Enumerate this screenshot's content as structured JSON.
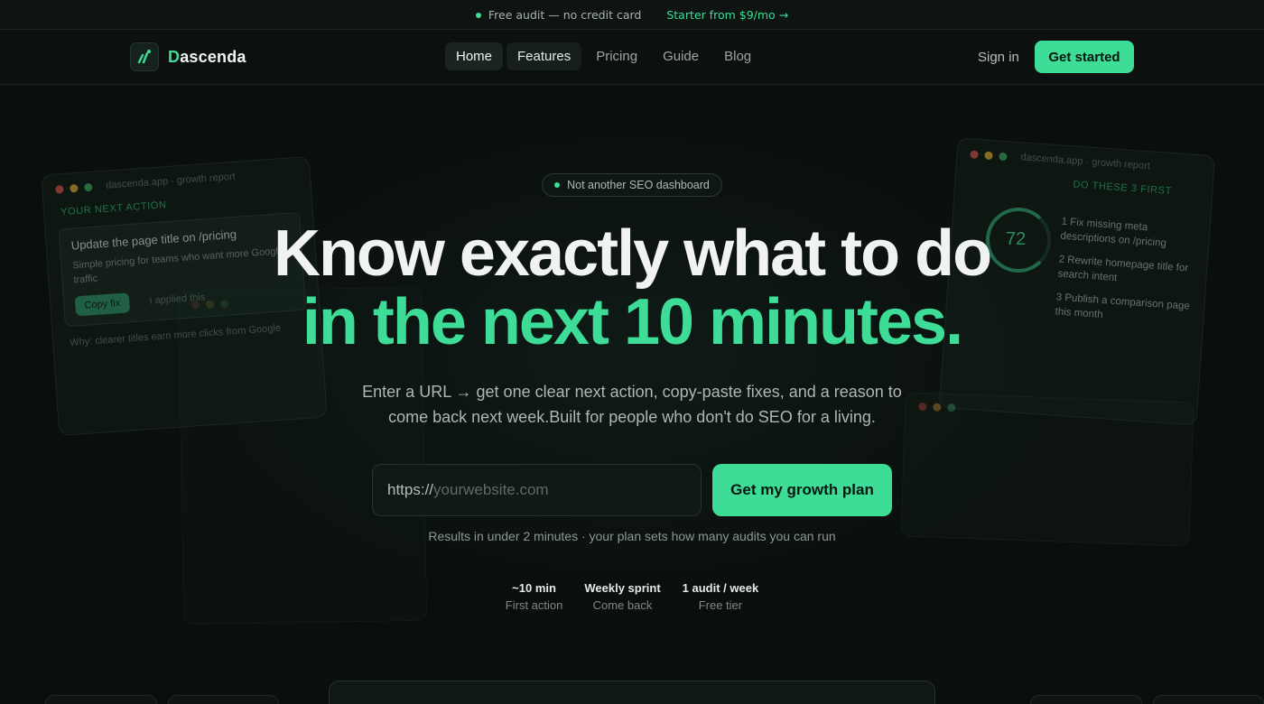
{
  "announcement": {
    "text": "Free audit — no credit card",
    "link": "Starter from $9/mo →"
  },
  "nav": {
    "brand_accent": "D",
    "brand_rest": "ascenda",
    "links": [
      "Home",
      "Features",
      "Pricing",
      "Guide",
      "Blog"
    ],
    "signin": "Sign in",
    "cta": "Get started"
  },
  "hero": {
    "badge": "Not another SEO dashboard",
    "title_line1": "Know exactly what to do",
    "title_line2": "in the next 10 minutes.",
    "subtitle": "Enter a URL → get one clear next action, copy-paste fixes, and a reason to come back next week.Built for people who don't do SEO for a living.",
    "input_prefix": "https://",
    "input_placeholder": "yourwebsite.com",
    "cta": "Get my growth plan",
    "note": "Results in under 2 minutes · your plan sets how many audits you can run",
    "stats": [
      {
        "value": "~10 min",
        "label": "First action"
      },
      {
        "value": "Weekly sprint",
        "label": "Come back"
      },
      {
        "value": "1 audit / week",
        "label": "Free tier"
      }
    ]
  },
  "preview_left": {
    "bar_title": "dascenda.app · growth report",
    "section": "YOUR NEXT ACTION",
    "card_title": "Update the page title on /pricing",
    "card_text": "Simple pricing for teams who want more Google traffic",
    "copy_button": "Copy fix",
    "applied": "I applied this",
    "why": "Why: clearer titles earn more clicks from Google"
  },
  "preview_right": {
    "bar_title": "dascenda.app · growth report",
    "score": "72",
    "section": "DO THESE 3 FIRST",
    "items": [
      "1  Fix missing meta descriptions on /pricing",
      "2  Rewrite homepage title for search intent",
      "3  Publish a comparison page this month"
    ]
  },
  "colors": {
    "accent": "#3ddc97",
    "background": "#0a0f0d"
  }
}
